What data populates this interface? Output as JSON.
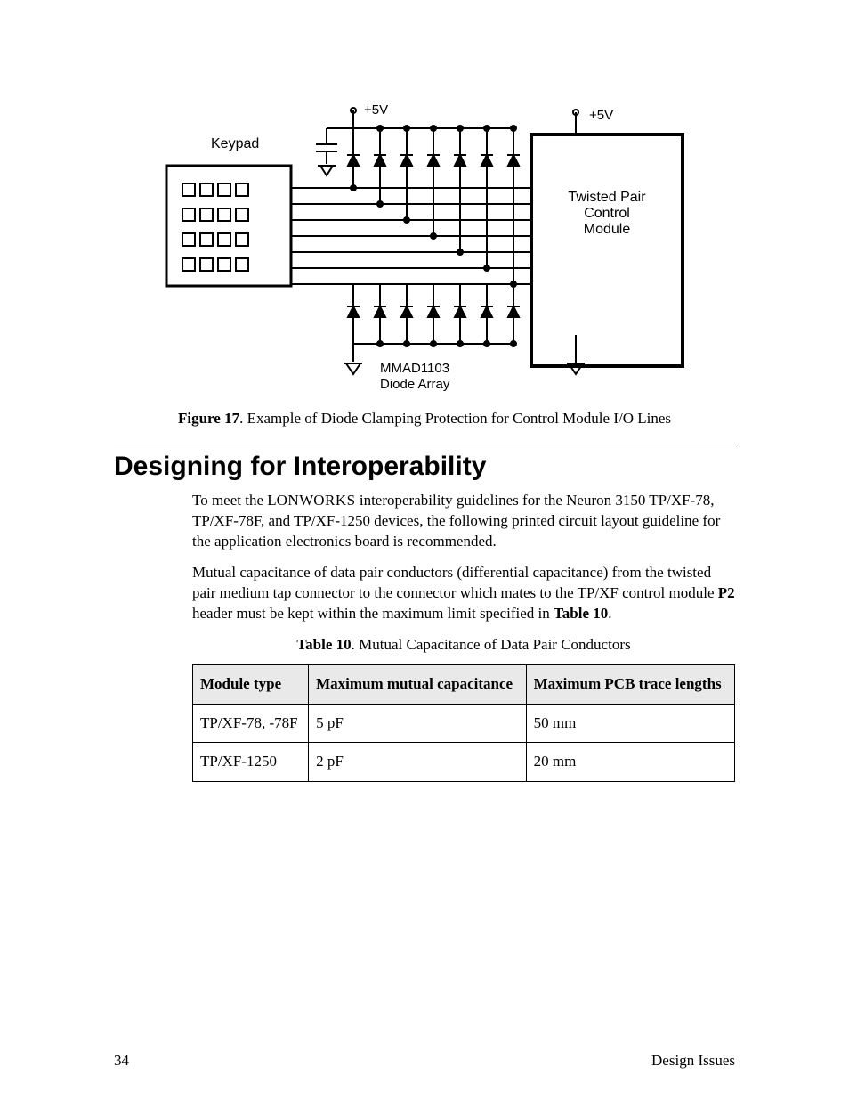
{
  "figure": {
    "labels": {
      "keypad": "Keypad",
      "v5_left": "+5V",
      "v5_right": "+5V",
      "module_l1": "Twisted Pair",
      "module_l2": "Control",
      "module_l3": "Module",
      "diode_l1": "MMAD1103",
      "diode_l2": "Diode Array"
    },
    "caption_bold": "Figure 17",
    "caption_rest": ". Example of Diode Clamping Protection for Control Module I/O Lines"
  },
  "heading": "Designing for Interoperability",
  "para1_a": "To meet the L",
  "para1_b": "ON",
  "para1_c": "W",
  "para1_d": "ORKS",
  "para1_e": " interoperability guidelines for the Neuron 3150 TP/XF-78, TP/XF-78F, and TP/XF-1250 devices, the following printed circuit layout guideline for the application electronics board is recommended.",
  "para2_a": "Mutual capacitance of data pair conductors (differential capacitance) from the twisted pair medium tap connector to the connector which mates to the TP/XF control module ",
  "para2_b": "P2",
  "para2_c": " header must be kept within the maximum limit specified in ",
  "para2_d": "Table 10",
  "para2_e": ".",
  "table": {
    "caption_bold": "Table 10",
    "caption_rest": ". Mutual Capacitance of Data Pair Conductors",
    "headers": {
      "c1": "Module type",
      "c2": "Maximum mutual capacitance",
      "c3": "Maximum PCB trace lengths"
    },
    "rows": [
      {
        "c1": "TP/XF-78, -78F",
        "c2": "5 pF",
        "c3": "50 mm"
      },
      {
        "c1": "TP/XF-1250",
        "c2": "2 pF",
        "c3": "20 mm"
      }
    ]
  },
  "footer": {
    "page": "34",
    "section": "Design Issues"
  }
}
